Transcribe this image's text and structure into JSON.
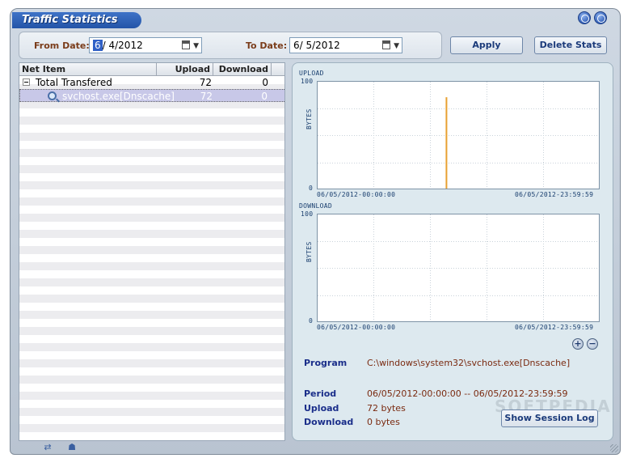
{
  "window": {
    "title": "Traffic Statistics"
  },
  "toolbar": {
    "from_label": "From Date:",
    "from_month": "6",
    "from_rest": "/  4/2012",
    "to_label": "To Date:",
    "to_value": "6/  5/2012",
    "apply_label": "Apply",
    "delete_label": "Delete Stats"
  },
  "table": {
    "headers": {
      "item": "Net Item",
      "upload": "Upload",
      "download": "Download"
    },
    "rows": [
      {
        "name": "Total Transfered",
        "upload": "72",
        "download": "0"
      },
      {
        "name": "svchost.exe[Dnscache]",
        "upload": "72",
        "download": "0"
      }
    ]
  },
  "upload_chart": {
    "title": "UPLOAD",
    "ylabel": "BYTES",
    "ymax_label": "100",
    "ymin_label": "0",
    "x_start": "06/05/2012-00:00:00",
    "x_end": "06/05/2012-23:59:59"
  },
  "download_chart": {
    "title": "DOWNLOAD",
    "ylabel": "BYTES",
    "ymax_label": "100",
    "ymin_label": "0",
    "x_start": "06/05/2012-00:00:00",
    "x_end": "06/05/2012-23:59:59"
  },
  "chart_data": [
    {
      "type": "bar",
      "title": "UPLOAD",
      "ylabel": "BYTES",
      "ylim": [
        0,
        100
      ],
      "xlim": [
        "06/05/2012-00:00:00",
        "06/05/2012-23:59:59"
      ],
      "x": [
        "06/05/2012-11:00:00"
      ],
      "values": [
        85
      ],
      "grid": true,
      "color": "#e8a030"
    },
    {
      "type": "bar",
      "title": "DOWNLOAD",
      "ylabel": "BYTES",
      "ylim": [
        0,
        100
      ],
      "xlim": [
        "06/05/2012-00:00:00",
        "06/05/2012-23:59:59"
      ],
      "x": [],
      "values": [],
      "grid": true,
      "color": "#e8a030"
    }
  ],
  "details": {
    "program_label": "Program",
    "program_value": "C:\\windows\\system32\\svchost.exe[Dnscache]",
    "period_label": "Period",
    "period_value": "06/05/2012-00:00:00 -- 06/05/2012-23:59:59",
    "upload_label": "Upload",
    "upload_value": "72 bytes",
    "download_label": "Download",
    "download_value": "0 bytes",
    "show_log_label": "Show Session Log"
  },
  "watermark": "SOFTPEDIA",
  "colors": {
    "accent": "#2354a8",
    "label": "#1a2e8a",
    "value": "#7a2a10",
    "bar": "#e8a030"
  }
}
